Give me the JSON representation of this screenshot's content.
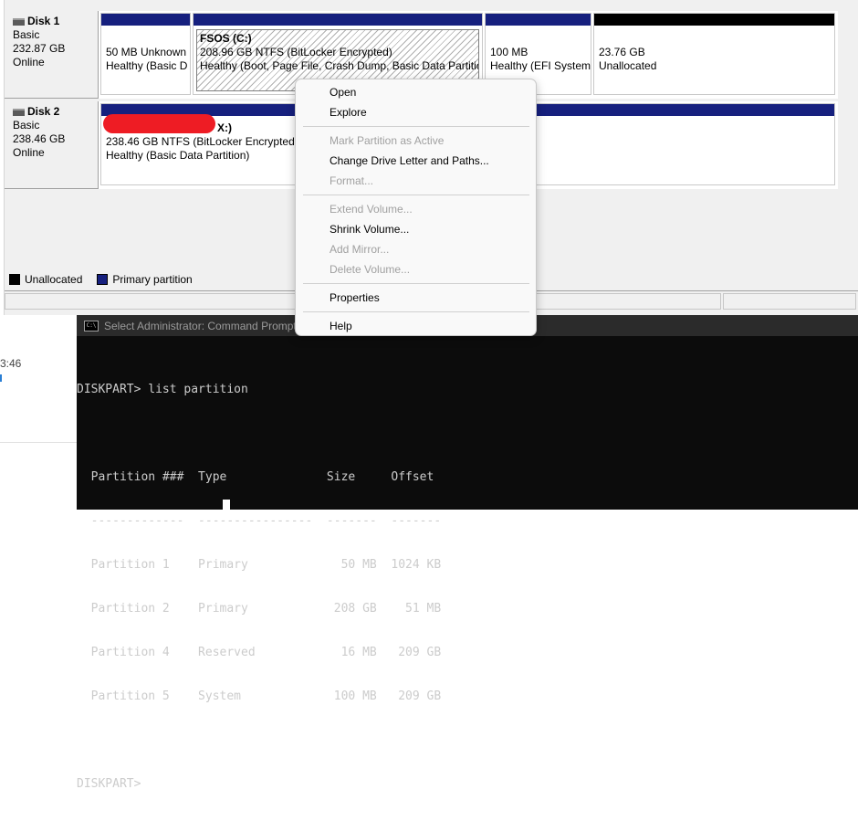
{
  "disks": [
    {
      "name": "Disk 1",
      "type": "Basic",
      "size": "232.87 GB",
      "status": "Online"
    },
    {
      "name": "Disk 2",
      "type": "Basic",
      "size": "238.46 GB",
      "status": "Online"
    }
  ],
  "disk1_partitions": [
    {
      "line1": "50 MB Unknown",
      "line2": "Healthy (Basic D"
    },
    {
      "title": "FSOS  (C:)",
      "line1": "208.96 GB NTFS (BitLocker Encrypted)",
      "line2": "Healthy (Boot, Page File, Crash Dump, Basic Data Partition"
    },
    {
      "line1": "100 MB",
      "line2": "Healthy (EFI System"
    },
    {
      "line1": "23.76 GB",
      "line2": "Unallocated"
    }
  ],
  "disk2_partition": {
    "title_suffix": "X:)",
    "line1": "238.46 GB NTFS (BitLocker Encrypted)",
    "line2": "Healthy (Basic Data Partition)"
  },
  "legend": [
    {
      "label": "Unallocated",
      "color": "#000000"
    },
    {
      "label": "Primary partition",
      "color": "#16207e"
    }
  ],
  "context_menu": [
    {
      "label": "Open",
      "enabled": true
    },
    {
      "label": "Explore",
      "enabled": true
    },
    {
      "label": "Mark Partition as Active",
      "enabled": false
    },
    {
      "label": "Change Drive Letter and Paths...",
      "enabled": true
    },
    {
      "label": "Format...",
      "enabled": false
    },
    {
      "label": "Extend Volume...",
      "enabled": false
    },
    {
      "label": "Shrink Volume...",
      "enabled": true
    },
    {
      "label": "Add Mirror...",
      "enabled": false
    },
    {
      "label": "Delete Volume...",
      "enabled": false
    },
    {
      "label": "Properties",
      "enabled": true
    },
    {
      "label": "Help",
      "enabled": true
    }
  ],
  "cmd": {
    "title": "Select Administrator: Command Prompt",
    "icon_text": "C:\\",
    "lines": [
      "DISKPART> list partition",
      "",
      "  Partition ###  Type              Size     Offset",
      "  -------------  ----------------  -------  -------",
      "  Partition 1    Primary             50 MB  1024 KB",
      "  Partition 2    Primary            208 GB    51 MB",
      "  Partition 4    Reserved            16 MB   209 GB",
      "  Partition 5    System             100 MB   209 GB",
      "",
      "DISKPART>"
    ]
  },
  "background": {
    "time_fragment": "3:46"
  },
  "colors": {
    "primary_partition": "#16207e",
    "unallocated": "#000000",
    "redaction": "#ee1c24"
  }
}
